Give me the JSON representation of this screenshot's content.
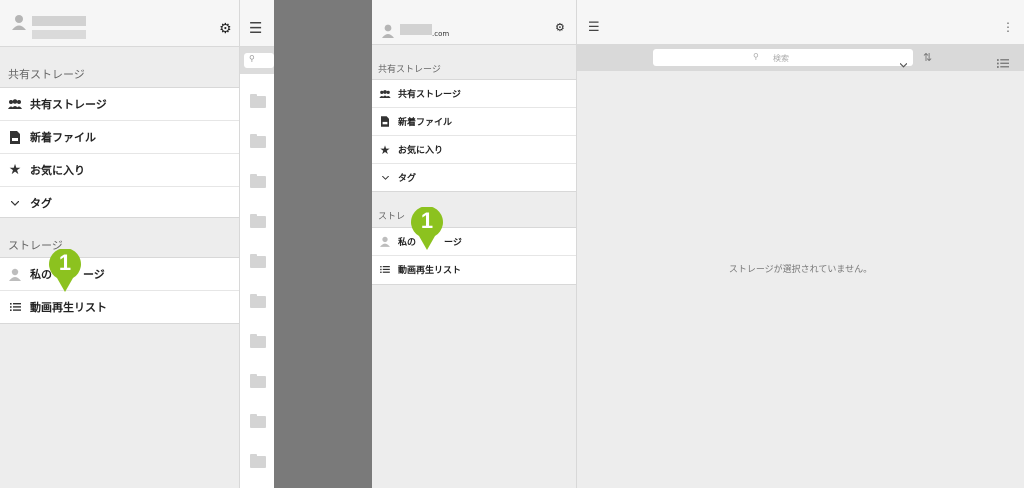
{
  "left_panel": {
    "domain_suffix": "",
    "shared_section_title": "共有ストレージ",
    "shared_items": [
      {
        "label": "共有ストレージ",
        "icon": "group-icon"
      },
      {
        "label": "新着ファイル",
        "icon": "new-file-icon"
      },
      {
        "label": "お気に入り",
        "icon": "star-icon"
      },
      {
        "label": "タグ",
        "icon": "chevron-down-icon"
      }
    ],
    "storage_section_title": "ストレージ",
    "storage_items": [
      {
        "label_start": "私の",
        "label_end": "ージ",
        "icon": "user-icon"
      },
      {
        "label": "動画再生リスト",
        "icon": "list-icon"
      }
    ]
  },
  "right_panel": {
    "domain_suffix": ".com",
    "shared_section_title": "共有ストレージ",
    "shared_items": [
      {
        "label": "共有ストレージ",
        "icon": "group-icon"
      },
      {
        "label": "新着ファイル",
        "icon": "new-file-icon"
      },
      {
        "label": "お気に入り",
        "icon": "star-icon"
      },
      {
        "label": "タグ",
        "icon": "chevron-down-icon"
      }
    ],
    "storage_section_title": "ストレ",
    "storage_items": [
      {
        "label_start": "私の",
        "label_end": "ージ",
        "icon": "user-icon"
      },
      {
        "label": "動画再生リスト",
        "icon": "list-icon"
      }
    ],
    "search_placeholder": "検索",
    "empty_message": "ストレージが選択されていません。"
  },
  "callouts": [
    "1",
    "1"
  ],
  "colors": {
    "accent_green": "#8cc21f",
    "divider_gray": "#7a7a7a"
  }
}
